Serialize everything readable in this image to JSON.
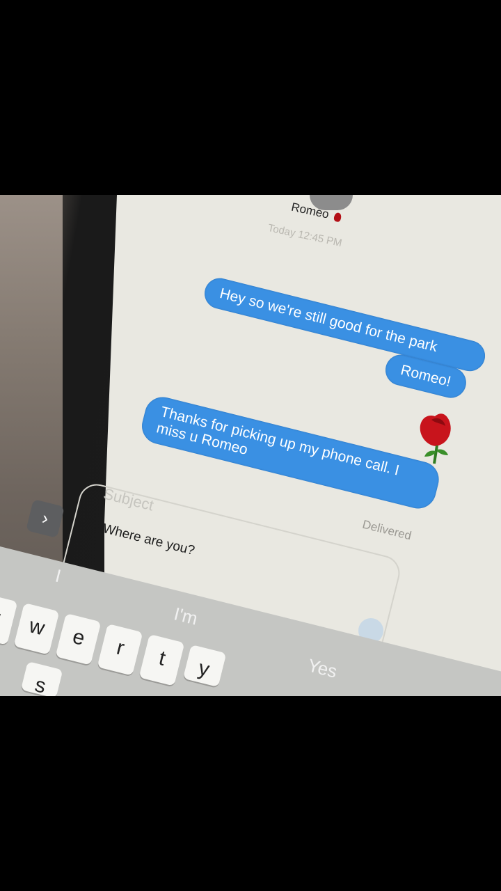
{
  "conversation": {
    "contact_name": "Romeo",
    "timestamp": "Today 12:45 PM",
    "messages": [
      {
        "text": "Hey so we're still good for the park"
      },
      {
        "text": "Romeo!"
      },
      {
        "text": "Thanks for picking up my phone call. I miss u Romeo"
      }
    ],
    "status": "Delivered"
  },
  "composer": {
    "subject_placeholder": "Subject",
    "message_value": "Where are you?",
    "apps_glyph": "›"
  },
  "keyboard": {
    "suggestions": [
      "I",
      "I'm",
      "Yes"
    ],
    "keys": [
      "q",
      "w",
      "e",
      "r",
      "t",
      "y",
      "s"
    ]
  },
  "colors": {
    "bubble": "#3a90e3",
    "screen_bg": "#e9e8e1"
  }
}
